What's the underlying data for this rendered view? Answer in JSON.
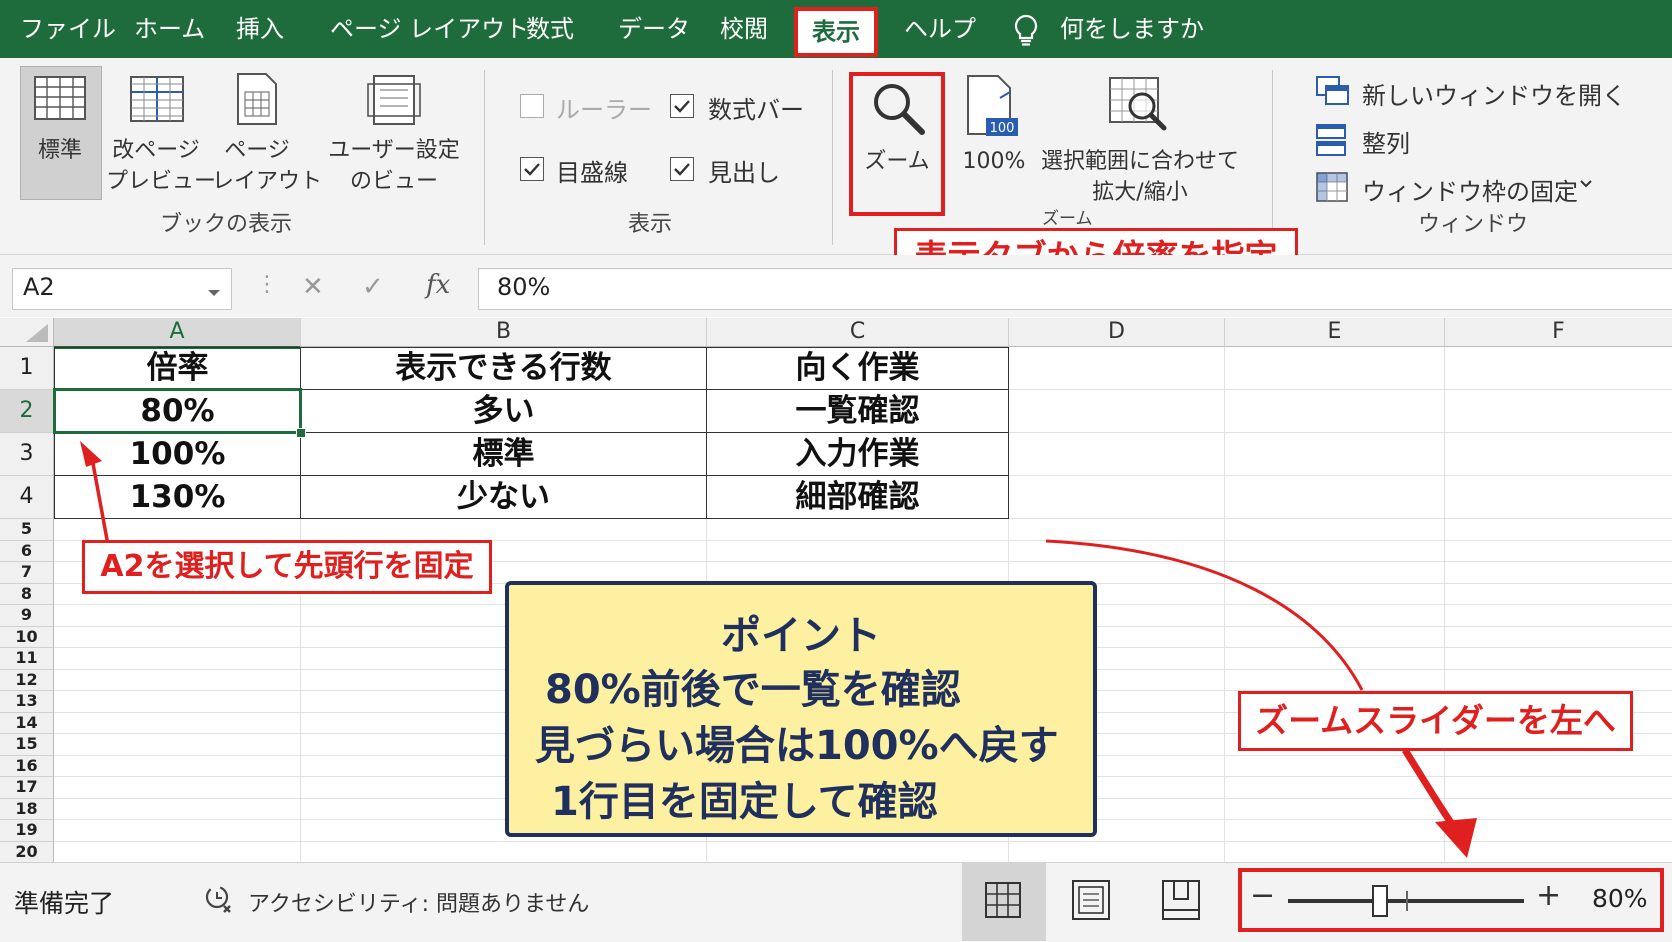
{
  "menu": {
    "file": "ファイル",
    "home": "ホーム",
    "insert": "挿入",
    "page_layout": "ページ レイアウト",
    "formulas": "数式",
    "data": "データ",
    "review": "校閲",
    "view": "表示",
    "help": "ヘルプ",
    "tell_me": "何をしますか"
  },
  "ribbon": {
    "normal": "標準",
    "page_break_1": "改ページ",
    "page_break_2": "プレビュー",
    "page_layout_1": "ページ",
    "page_layout_2": "レイアウト",
    "custom_view_1": "ユーザー設定",
    "custom_view_2": "のビュー",
    "group_workbook_views": "ブックの表示",
    "ruler": "ルーラー",
    "formula_bar": "数式バー",
    "gridlines": "目盛線",
    "headings": "見出し",
    "group_show": "表示",
    "zoom": "ズーム",
    "zoom100": "100%",
    "zoom100_icon_text": "100",
    "zoom_sel_1": "選択範囲に合わせて",
    "zoom_sel_2": "拡大/縮小",
    "group_zoom": "ズーム",
    "new_window": "新しいウィンドウを開く",
    "arrange": "整列",
    "freeze": "ウィンドウ枠の固定",
    "group_window": "ウィンドウ"
  },
  "formula_bar": {
    "name_box": "A2",
    "fx": "fx",
    "value": "80%"
  },
  "columns": [
    "A",
    "B",
    "C",
    "D",
    "E",
    "F"
  ],
  "rows": [
    "1",
    "2",
    "3",
    "4",
    "5",
    "6",
    "7",
    "8",
    "9",
    "10",
    "11",
    "12",
    "13",
    "14",
    "15",
    "16",
    "17",
    "18",
    "19",
    "20"
  ],
  "table": {
    "header": [
      "倍率",
      "表示できる行数",
      "向く作業"
    ],
    "rows": [
      [
        "80%",
        "多い",
        "一覧確認"
      ],
      [
        "100%",
        "標準",
        "入力作業"
      ],
      [
        "130%",
        "少ない",
        "細部確認"
      ]
    ]
  },
  "callouts": {
    "view_tab": "表示タブから倍率を指定",
    "a2": "A2を選択して先頭行を固定",
    "slider": "ズームスライダーを左へ"
  },
  "point": {
    "title": "ポイント",
    "line1": "80%前後で一覧を確認",
    "line2": "見づらい場合は100%へ戻す",
    "line3": "1行目を固定して確認"
  },
  "status": {
    "ready": "準備完了",
    "accessibility": "アクセシビリティ: 問題ありません",
    "zoom_minus": "−",
    "zoom_plus": "+",
    "zoom_level": "80%",
    "zoom_level_fraction": 0.8
  },
  "colors": {
    "excel_green": "#1e6b3c",
    "callout_red": "#e01f1f",
    "point_bg": "#fdf0a0",
    "point_text": "#1f2f5e"
  }
}
